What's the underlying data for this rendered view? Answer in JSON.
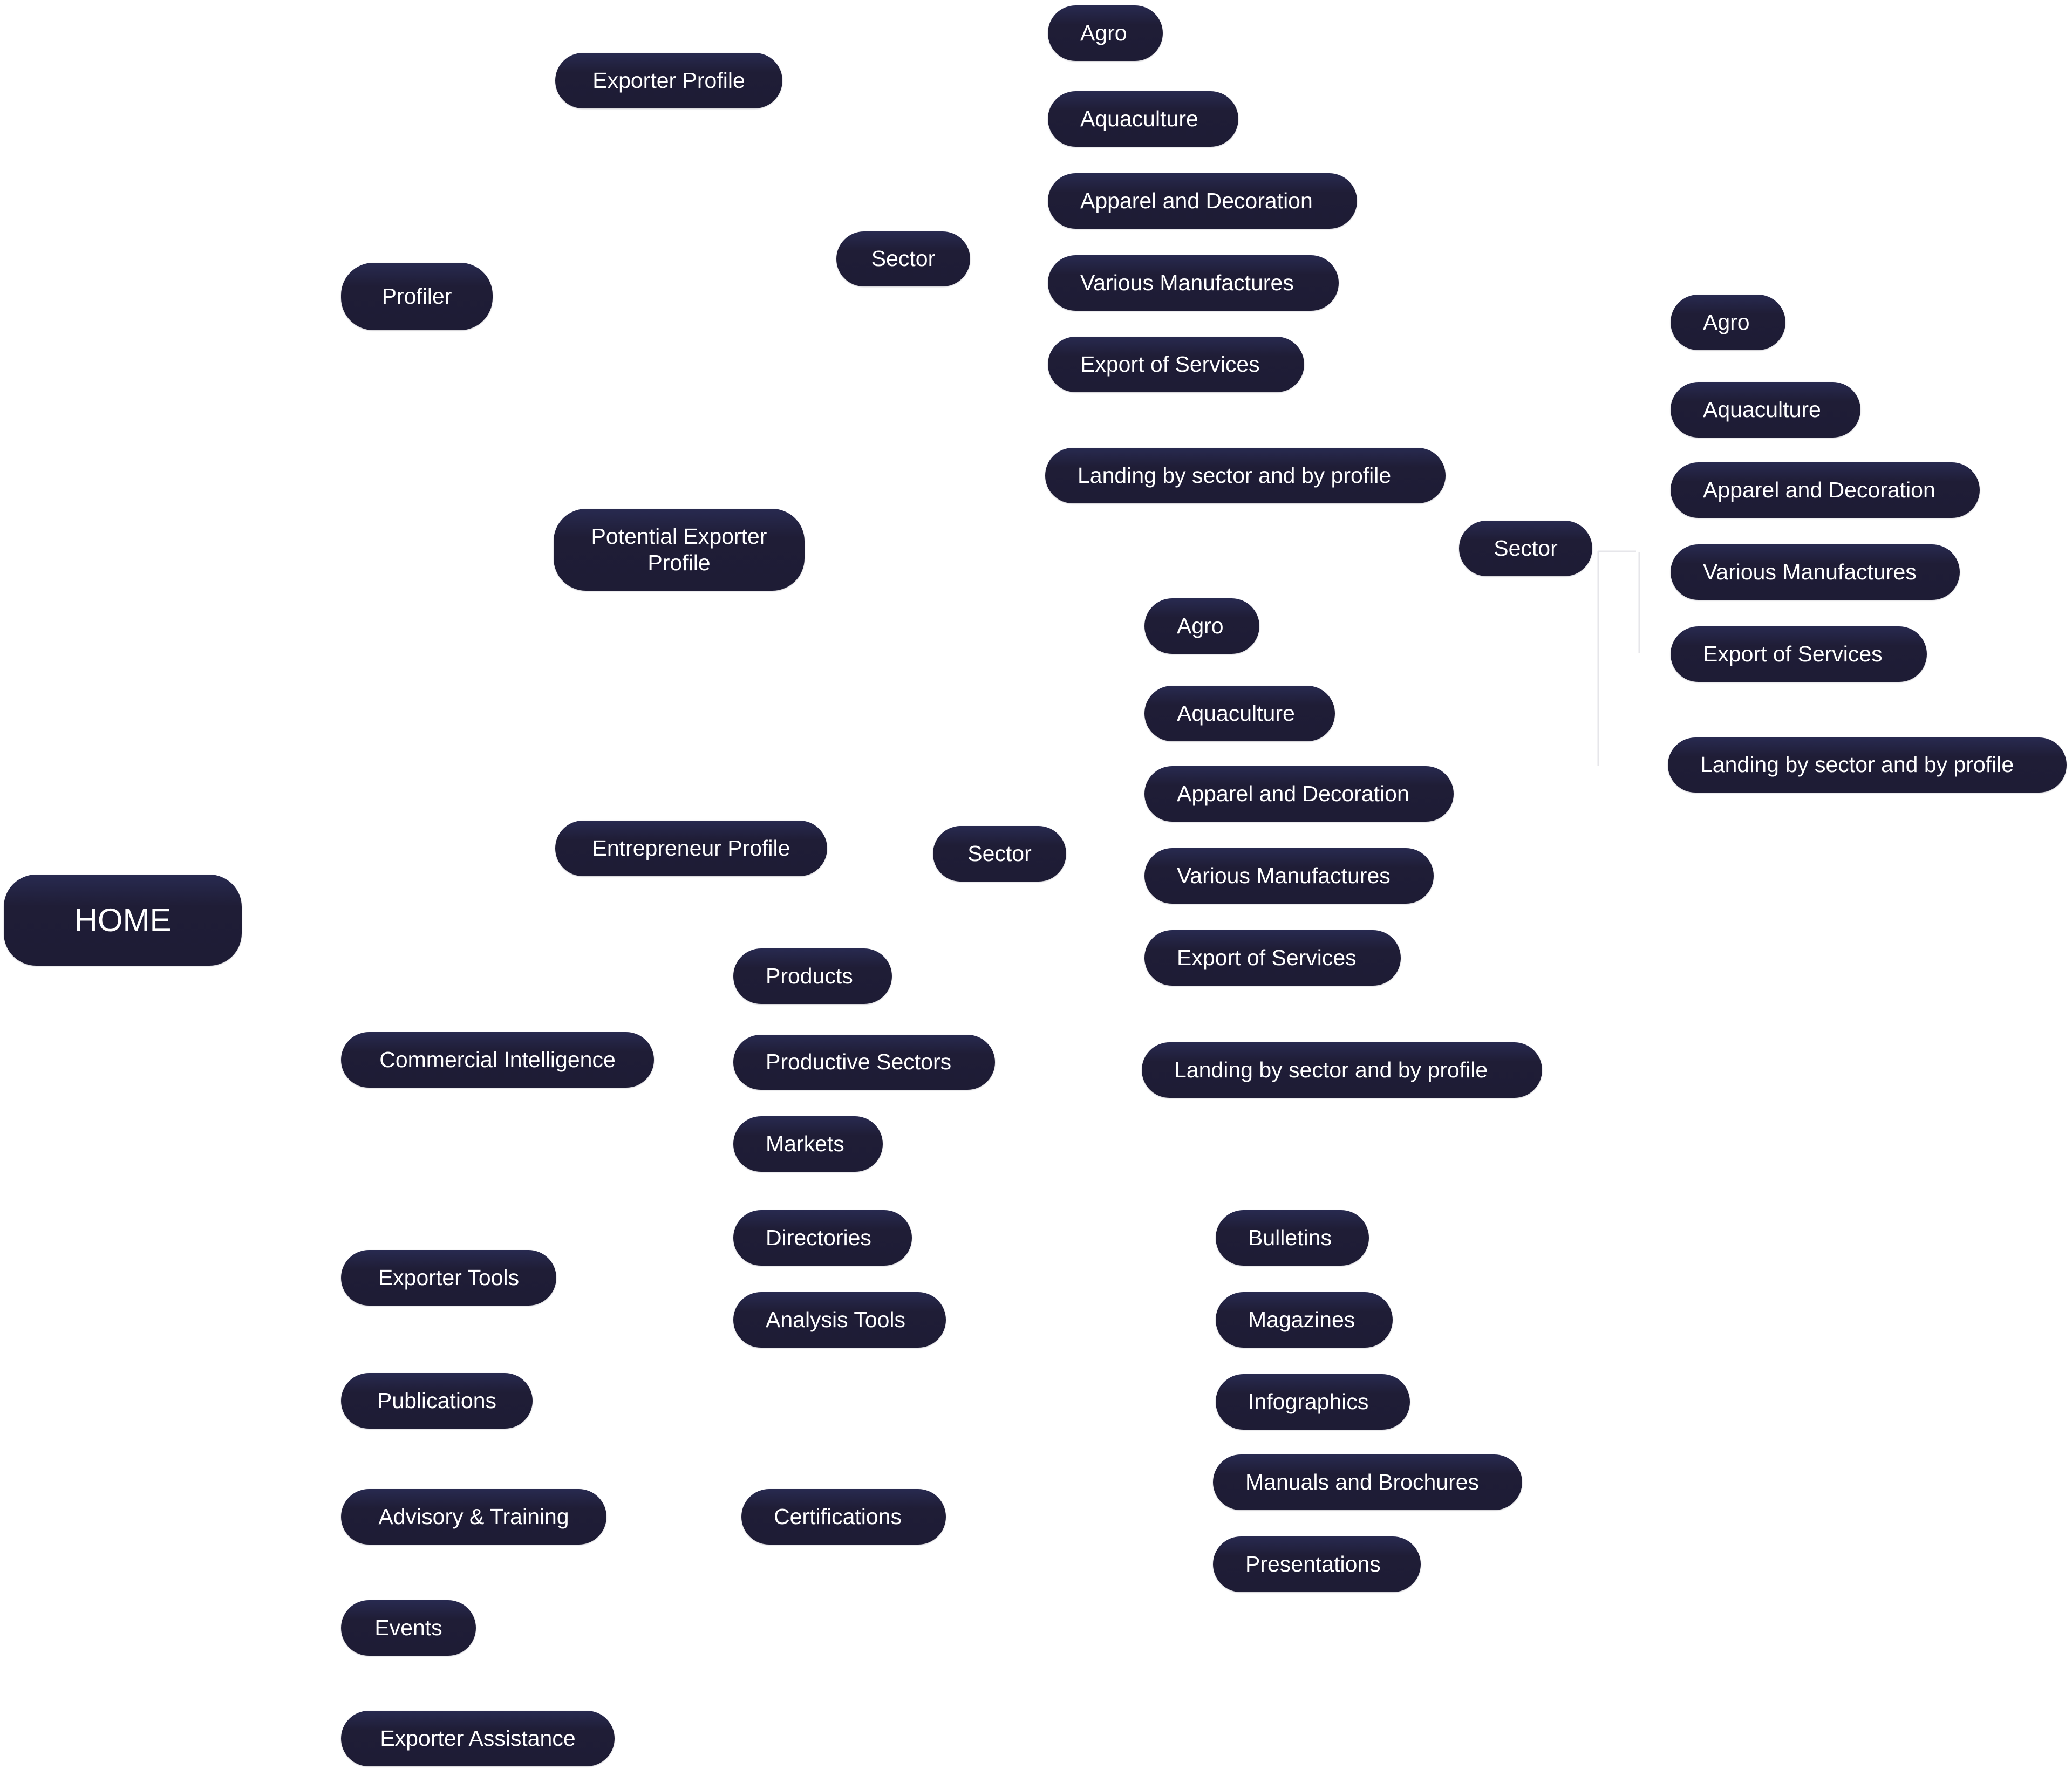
{
  "diagram": {
    "type": "sitemap",
    "root": "HOME",
    "nodes": {
      "home": "HOME",
      "profiler": "Profiler",
      "exporter_profile": "Exporter Profile",
      "potential_exporter_profile": "Potential Exporter Profile",
      "entrepreneur_profile": "Entrepreneur Profile",
      "commercial_intelligence": "Commercial Intelligence",
      "exporter_tools": "Exporter Tools",
      "publications": "Publications",
      "advisory_training": "Advisory & Training",
      "events": "Events",
      "exporter_assistance": "Exporter Assistance",
      "products": "Products",
      "productive_sectors": "Productive Sectors",
      "markets": "Markets",
      "directories": "Directories",
      "analysis_tools": "Analysis Tools",
      "certifications": "Certifications",
      "bulletins": "Bulletins",
      "magazines": "Magazines",
      "infographics": "Infographics",
      "manuals_brochures": "Manuals and Brochures",
      "presentations": "Presentations"
    },
    "sector_groups": [
      {
        "parent": "Exporter Profile",
        "sector_label": "Sector",
        "items": [
          "Agro",
          "Aquaculture",
          "Apparel and Decoration",
          "Various Manufactures",
          "Export of Services"
        ],
        "landing": "Landing by sector and by profile"
      },
      {
        "parent": "Potential Exporter Profile",
        "sector_label": "Sector",
        "items": [
          "Agro",
          "Aquaculture",
          "Apparel and Decoration",
          "Various Manufactures",
          "Export of Services"
        ],
        "landing": "Landing by sector and by profile"
      },
      {
        "parent": "Entrepreneur Profile",
        "sector_label": "Sector",
        "items": [
          "Agro",
          "Aquaculture",
          "Apparel and Decoration",
          "Various Manufactures",
          "Export of Services"
        ],
        "landing": "Landing by sector and by profile"
      }
    ]
  },
  "colors": {
    "node_fill": "#1e1c35",
    "node_fill_top": "#282a50",
    "node_text": "#ffffff",
    "background": "#ffffff",
    "connector": "#e6e6ea"
  }
}
